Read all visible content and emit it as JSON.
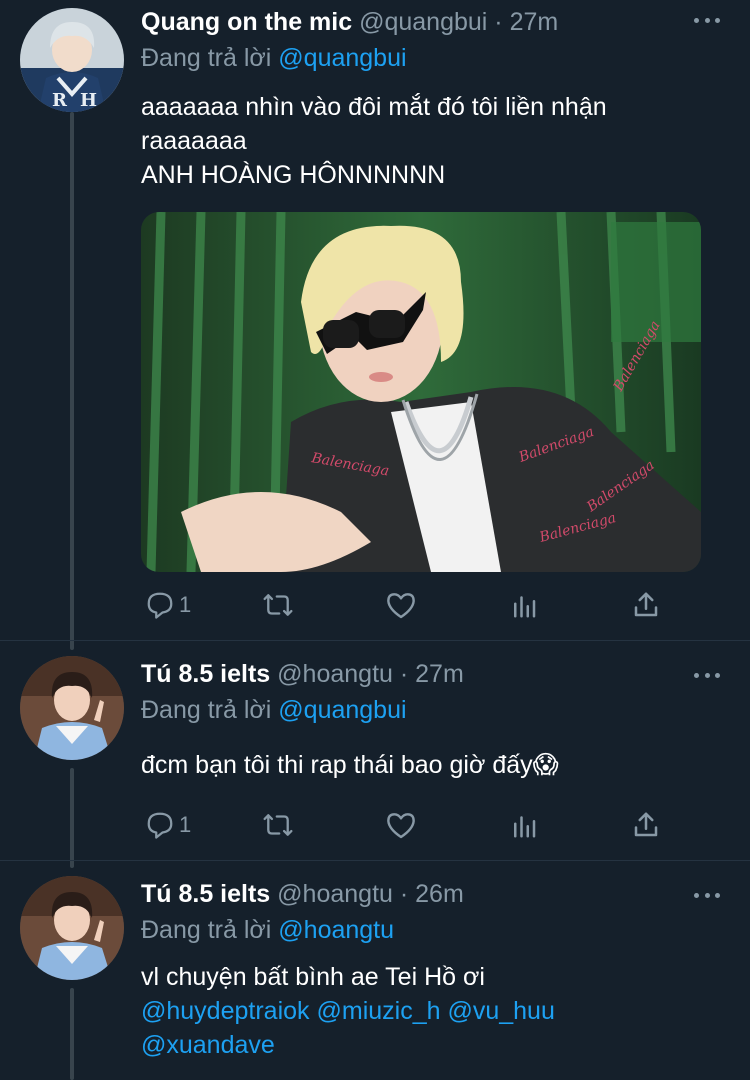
{
  "tweets": [
    {
      "name": "Quang on the mic",
      "handle": "@quangbui",
      "dot": "·",
      "time": "27m",
      "replying_prefix": "Đang trả lời ",
      "replying_to": "@quangbui",
      "text_lines": [
        "aaaaaaa nhìn vào đôi mắt đó tôi liền nhận",
        "raaaaaaa",
        "ANH HOÀNG HÔNNNNNN"
      ],
      "reply_count": "1",
      "has_photo": true
    },
    {
      "name": "Tú 8.5 ielts",
      "handle": "@hoangtu",
      "dot": "·",
      "time": "27m",
      "replying_prefix": "Đang trả lời ",
      "replying_to": "@quangbui",
      "text_lines": [
        "đcm bạn tôi thi rap thái bao giờ đấy😱"
      ],
      "reply_count": "1"
    },
    {
      "name": "Tú 8.5 ielts",
      "handle": "@hoangtu",
      "dot": "·",
      "time": "26m",
      "replying_prefix": "Đang trả lời ",
      "replying_to": "@hoangtu",
      "text_line1": "vl chuyện bất bình ae Tei Hồ ơi",
      "mentions_line2": [
        "@huydeptraiok",
        "@miuzic_h",
        "@vu_huu"
      ],
      "mentions_line3": [
        "@xuandave"
      ]
    }
  ],
  "icons": {
    "reply": "reply-icon",
    "retweet": "retweet-icon",
    "like": "heart-icon",
    "analytics": "analytics-icon",
    "share": "share-icon",
    "more": "more-icon"
  },
  "colors": {
    "background": "#15202b",
    "accent": "#1da1f2",
    "secondary_text": "#8899a6",
    "thread_line": "#38444d"
  }
}
